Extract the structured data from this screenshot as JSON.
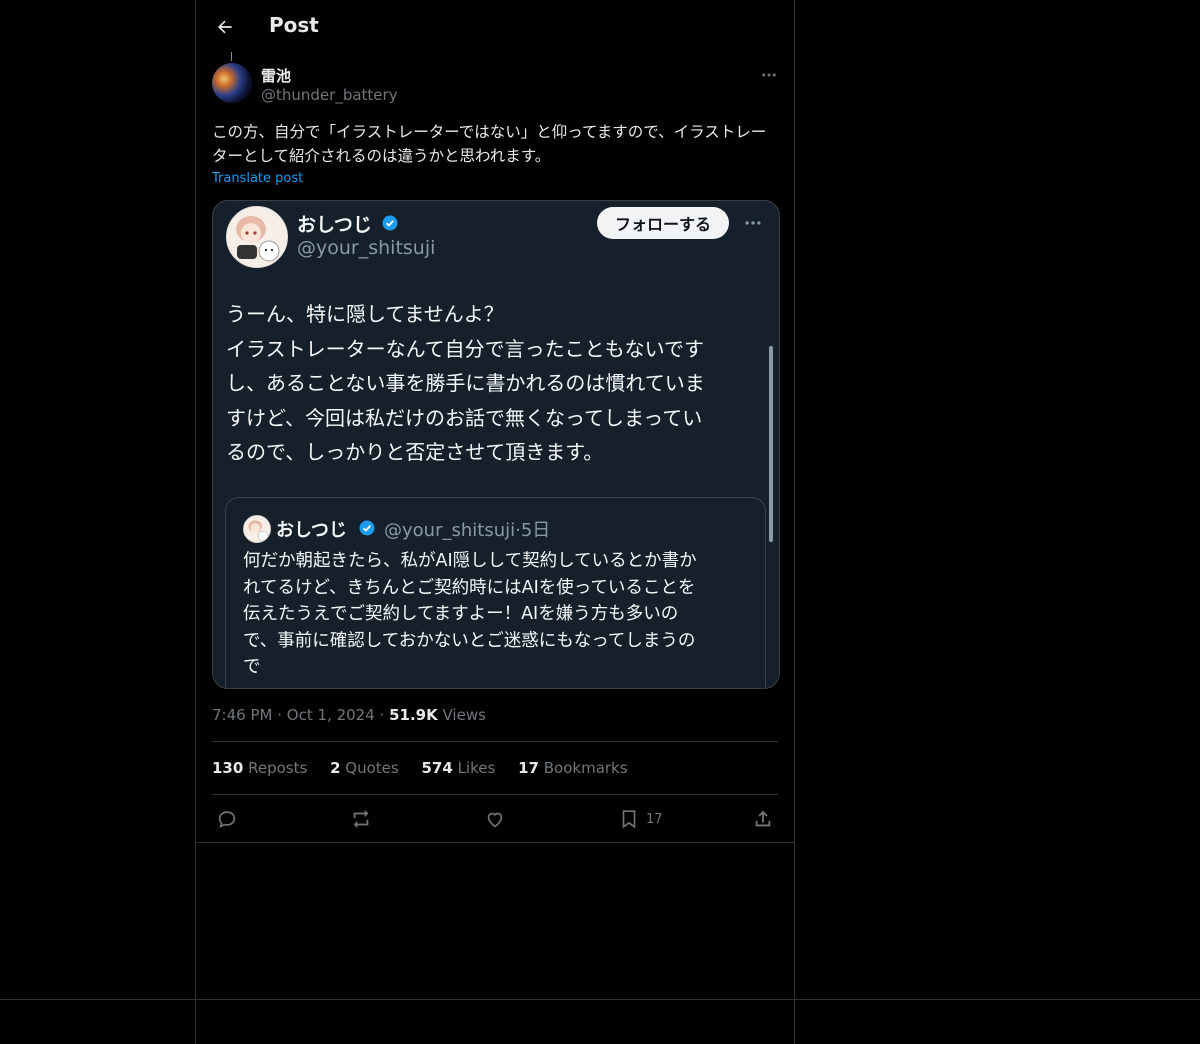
{
  "header": {
    "title": "Post"
  },
  "post": {
    "display_name": "雷池",
    "handle": "@thunder_battery",
    "text": "この方、自分で「イラストレーターではない」と仰ってますので、イラストレーターとして紹介されるのは違うかと思われます。",
    "translate_label": "Translate post",
    "time": "7:46 PM",
    "date": "Oct 1, 2024",
    "views_count": "51.9K",
    "views_label": "Views"
  },
  "media": {
    "display_name": "おしつじ",
    "handle": "@your_shitsuji",
    "follow_label": "フォローする",
    "text_lines": [
      "うーん、特に隠してませんよ？",
      "イラストレーターなんて自分で言ったこともないです",
      "し、あることない事を勝手に書かれるのは慣れていま",
      "すけど、今回は私だけのお話で無くなってしまってい",
      "るので、しっかりと否定させて頂きます。"
    ],
    "quote": {
      "display_name": "おしつじ",
      "handle": "@your_shitsuji",
      "age": "5日",
      "text_lines": [
        "何だか朝起きたら、私がAI隠しして契約しているとか書か",
        "れてるけど、きちんとご契約時にはAIを使っていることを",
        "伝えたうえでご契約してますよー！AIを嫌う方も多いの",
        "で、事前に確認しておかないとご迷惑にもなってしまうの",
        "で"
      ]
    }
  },
  "stats": {
    "reposts_count": "130",
    "reposts_label": "Reposts",
    "quotes_count": "2",
    "quotes_label": "Quotes",
    "likes_count": "574",
    "likes_label": "Likes",
    "bookmarks_count": "17",
    "bookmarks_label": "Bookmarks"
  },
  "actions": {
    "reply_icon": "reply-icon",
    "repost_icon": "repost-icon",
    "like_icon": "heart-icon",
    "bookmark_icon": "bookmark-icon",
    "bookmark_count": "17",
    "share_icon": "share-icon"
  },
  "colors": {
    "background": "#000000",
    "link": "#1d9bf0",
    "muted": "#71767b",
    "verified": "#1d9bf0"
  }
}
